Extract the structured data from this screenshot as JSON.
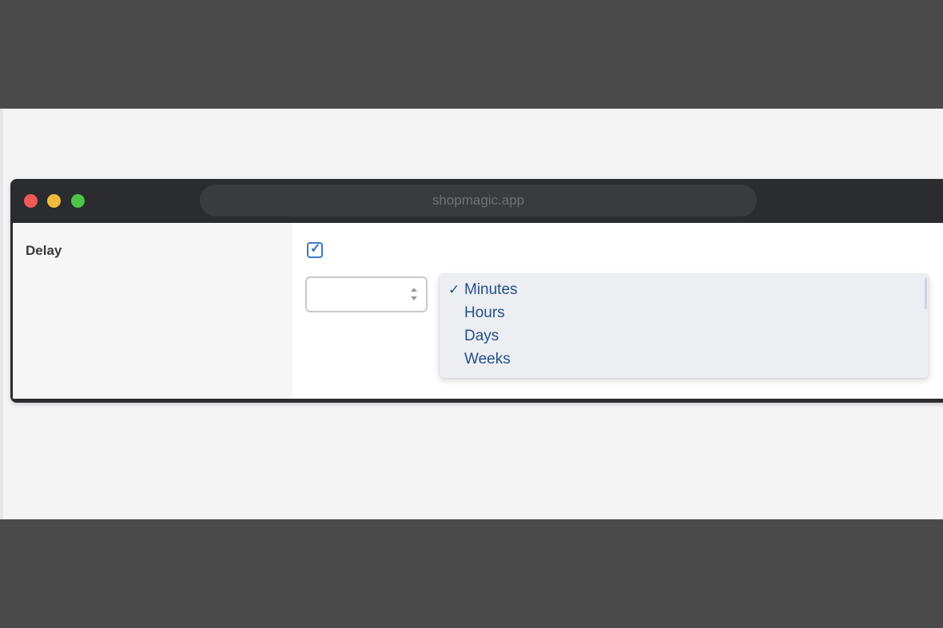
{
  "browser": {
    "url": "shopmagic.app"
  },
  "form": {
    "field_label": "Delay",
    "checkbox_checked": true,
    "number_value": "",
    "unit_options": [
      {
        "label": "Minutes",
        "selected": true
      },
      {
        "label": "Hours",
        "selected": false
      },
      {
        "label": "Days",
        "selected": false
      },
      {
        "label": "Weeks",
        "selected": false
      }
    ],
    "check_glyph": "✓"
  },
  "icons": {
    "checkbox_tick": "checkmark-icon",
    "spinner": "spinner-arrows-icon",
    "traffic_lights": [
      "close-icon",
      "minimize-icon",
      "maximize-icon"
    ]
  },
  "colors": {
    "traffic_red": "#ee5a55",
    "traffic_yellow": "#f3bb3e",
    "traffic_green": "#4cc446",
    "accent": "#3b78c8",
    "option_text": "#23508c",
    "dropdown_bg": "#eceef1",
    "titlebar": "#2b2c2f"
  }
}
